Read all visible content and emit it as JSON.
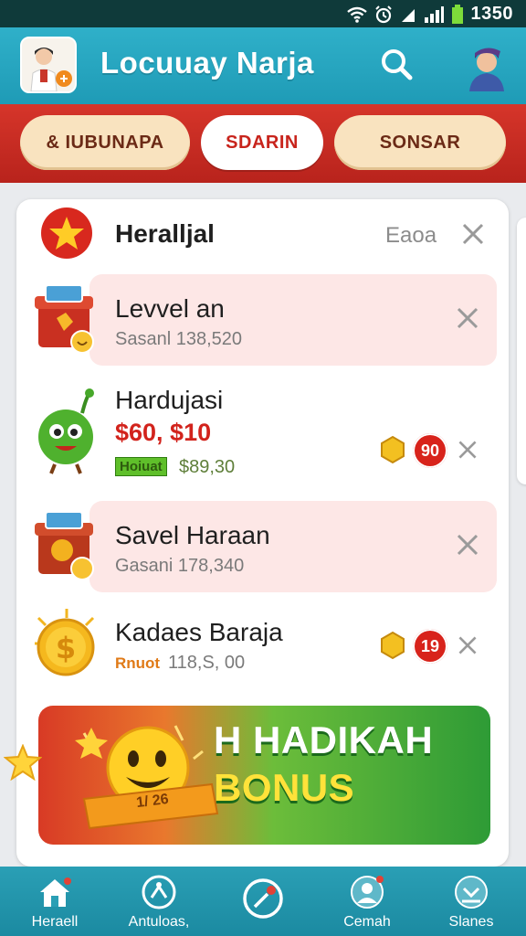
{
  "status_bar": {
    "time": "1350"
  },
  "header": {
    "title": "Locuuay Narja"
  },
  "tabs": [
    {
      "label": "& IUBUNAPA"
    },
    {
      "label": "SDARIN"
    },
    {
      "label": "SONSAR"
    }
  ],
  "list": {
    "header_item": {
      "title": "Heralljal",
      "side_label": "Eaoa"
    },
    "items": [
      {
        "title": "Levvel an",
        "subtitle": "Sasanl 138,520"
      },
      {
        "title": "Hardujasi",
        "price": "$60, $10",
        "tag": "Hoiuat",
        "subtitle": "$89,30",
        "badge": "90"
      },
      {
        "title": "Savel Haraan",
        "subtitle": "Gasani 178,340"
      },
      {
        "title": "Kadaes Baraja",
        "tag": "Rnuot",
        "subtitle": "118,S, 00",
        "badge": "19"
      }
    ]
  },
  "banner": {
    "line1": "H HADIKAH",
    "line2": "BONUS",
    "ribbon": "1/ 26"
  },
  "bottom_nav": [
    {
      "label": "Heraell"
    },
    {
      "label": "Antuloas,"
    },
    {
      "label": ""
    },
    {
      "label": "Cemah"
    },
    {
      "label": "Slanes"
    }
  ],
  "colors": {
    "header": "#1f9bb6",
    "tab_bar": "#c62a21",
    "accent_red": "#d2231c",
    "highlight_row": "#fde7e6",
    "bottom_nav": "#1b8aa1"
  }
}
